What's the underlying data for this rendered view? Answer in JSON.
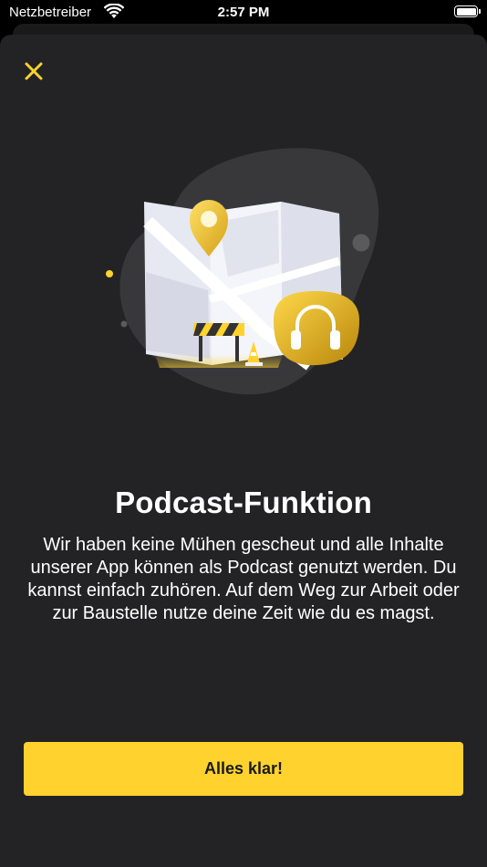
{
  "status_bar": {
    "carrier": "Netzbetreiber",
    "time": "2:57 PM",
    "wifi_icon": "wifi-icon",
    "battery_icon": "battery-icon"
  },
  "sheet": {
    "close_icon": "close-icon",
    "illustration": "map-podcast-illustration",
    "title": "Podcast-Funktion",
    "description": "Wir haben keine Mühen gescheut und alle Inhalte unserer App können als Podcast genutzt werden. Du kannst einfach zuhören. Auf dem Weg zur Arbeit oder zur Baustelle nutze deine Zeit wie du es magst.",
    "cta_label": "Alles klar!"
  },
  "colors": {
    "background": "#232325",
    "accent": "#ffd22e",
    "text": "#ffffff"
  }
}
